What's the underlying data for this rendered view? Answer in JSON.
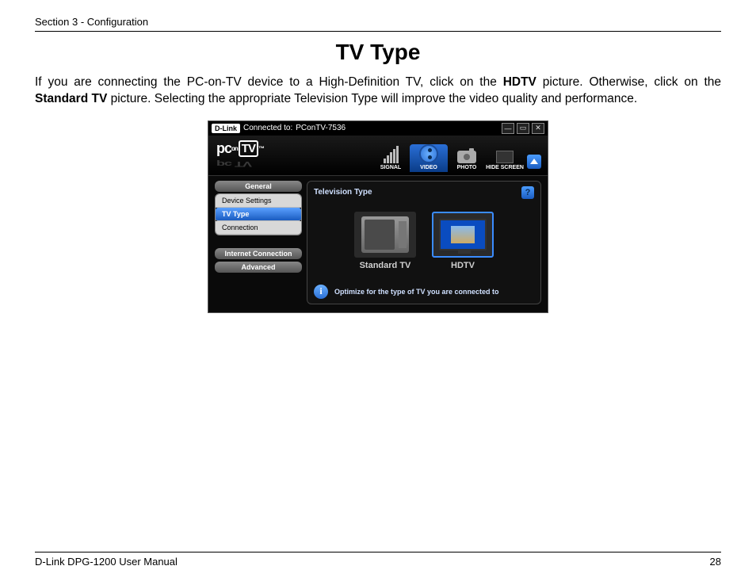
{
  "header": {
    "section": "Section 3 - Configuration"
  },
  "title": "TV Type",
  "body": {
    "pre1": "If you are connecting the PC-on-TV device to a High-Definition TV, click on the ",
    "b1": "HDTV",
    "mid": " picture. Otherwise, click on the ",
    "b2": "Standard TV",
    "post": " picture.  Selecting the appropriate Television Type will improve the video quality and performance."
  },
  "app": {
    "brand": "D-Link",
    "connected_label": "Connected to:",
    "connected_value": "PConTV-7536",
    "logo": {
      "pc": "pc",
      "on": "on",
      "tv": "TV"
    },
    "tabs": {
      "signal": "SIGNAL",
      "video": "VIDEO",
      "photo": "PHOTO",
      "hide": "HIDE SCREEN"
    },
    "sidebar": {
      "general": "General",
      "device_settings": "Device Settings",
      "tv_type": "TV Type",
      "connection": "Connection",
      "internet": "Internet Connection",
      "advanced": "Advanced"
    },
    "panel": {
      "title": "Television Type",
      "help": "?",
      "standard": "Standard TV",
      "hdtv": "HDTV",
      "info_icon": "i",
      "info_text": "Optimize for the type of TV you are connected to"
    }
  },
  "footer": {
    "left": "D-Link DPG-1200 User Manual",
    "right": "28"
  }
}
